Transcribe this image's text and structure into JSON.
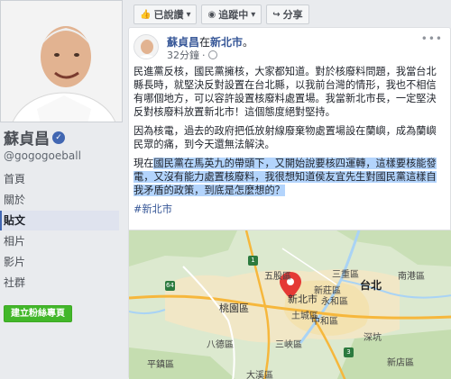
{
  "profile": {
    "name": "蘇貞昌",
    "handle": "@gogogoeball",
    "nav": [
      "首頁",
      "關於",
      "貼文",
      "相片",
      "影片",
      "社群"
    ],
    "active_index": 2,
    "create_page_label": "建立粉絲專頁"
  },
  "action_bar": {
    "liked_label": "已說讚",
    "following_label": "追蹤中",
    "share_label": "分享"
  },
  "post": {
    "author": "蘇貞昌",
    "at_word": "在",
    "place": "新北市",
    "at_suffix": "。",
    "time": "32分鐘",
    "paragraph1": "民進黨反核，國民黨擁核，大家都知道。對於核廢料問題，我當台北縣長時，就堅決反對設置在台北縣，以我前台灣的情形，我也不相信有哪個地方，可以容許設置核廢料處置場。我當新北市長，一定堅決反對核廢料放置新北市！這個態度絕對堅持。",
    "paragraph2": "因為核電，過去的政府把低放射線廢棄物處置場設在蘭嶼，成為蘭嶼民眾的痛，到今天還無法解決。",
    "paragraph3_prefix": "現在",
    "paragraph3_highlight": "國民黨在馬英九的帶頭下，又開始說要核四運轉，這樣要核能發電，又沒有能力處置核廢料，我很想知道侯友宜先生對國民黨這樣自我矛盾的政策，到底是怎麼想的？",
    "hashtag": "#新北市"
  },
  "map": {
    "labels": {
      "sanzhong": "三重區",
      "taipei": "台北",
      "nangang": "南港區",
      "xinzhuang": "新莊區",
      "banqiao": "新北市",
      "yonghe": "永和區",
      "taoyuan": "桃園區",
      "tucheng": "土城區",
      "zhonghe": "中和區",
      "bade": "八德區",
      "sanxia": "三峽區",
      "shenkeng": "深坑",
      "daxi": "大溪區",
      "wugu": "五股區",
      "pingzhen": "平鎮區",
      "xindian": "新店區"
    },
    "road_badges": [
      "1",
      "64",
      "3"
    ],
    "marker_color": "#e53935",
    "water_color": "#a9d3f5",
    "urban_color": "#f1e7c6"
  }
}
